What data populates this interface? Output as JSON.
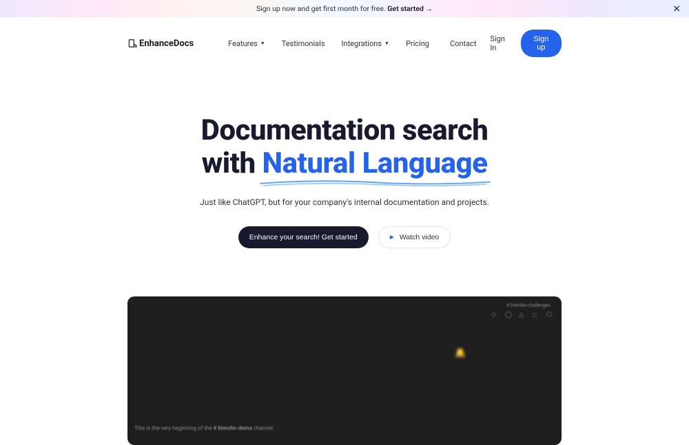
{
  "promo": {
    "text": "Sign up now and get first month for free. ",
    "cta": "Get started →"
  },
  "brand": {
    "name": "EnhanceDocs"
  },
  "nav": {
    "features": "Features",
    "testimonials": "Testimonials",
    "integrations": "Integrations",
    "pricing": "Pricing",
    "contact": "Contact",
    "signin": "Sign In",
    "signup": "Sign up"
  },
  "hero": {
    "title_line1": "Documentation search",
    "title_line2_prefix": "with ",
    "title_line2_highlight": "Natural Language",
    "subtitle": "Just like ChatGPT, but for your company's internal documentation and projects.",
    "cta_primary": "Enhance your search! Get started",
    "cta_secondary": "Watch video"
  },
  "video": {
    "top_label": "# blendie-challenges",
    "caption_prefix": "This is the very beginning of the ",
    "caption_channel": "# blendie-demo",
    "caption_suffix": " channel."
  }
}
